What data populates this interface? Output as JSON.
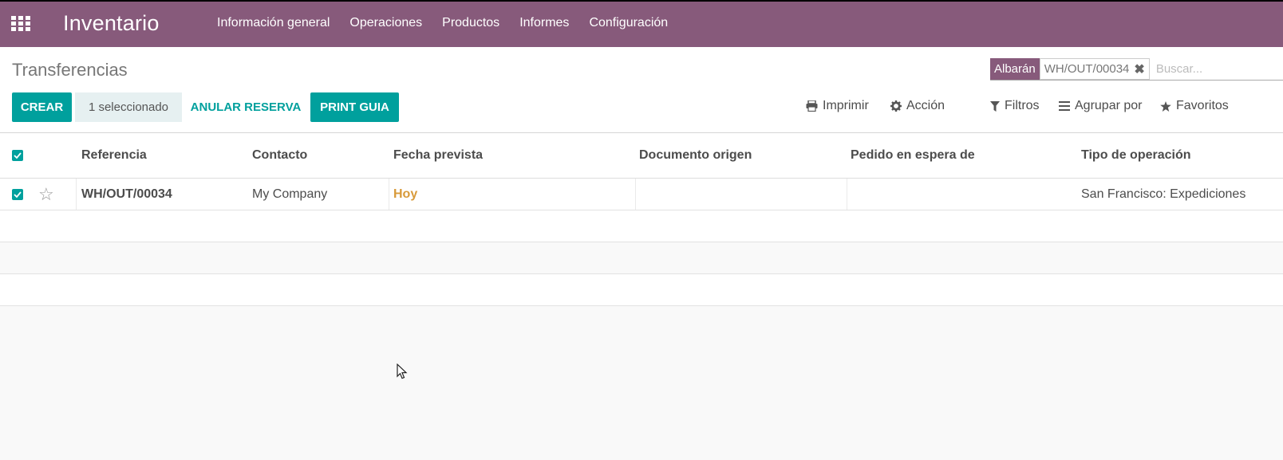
{
  "navbar": {
    "app_name": "Inventario",
    "menu": [
      "Información general",
      "Operaciones",
      "Productos",
      "Informes",
      "Configuración"
    ]
  },
  "control": {
    "breadcrumb": "Transferencias",
    "buttons": {
      "create": "CREAR",
      "selected": "1 seleccionado",
      "unreserve": "ANULAR RESERVA",
      "print_guia": "PRINT GUIA"
    },
    "search": {
      "facet_label": "Albarán",
      "facet_value": "WH/OUT/00034",
      "placeholder": "Buscar..."
    },
    "tools": {
      "print": "Imprimir",
      "action": "Acción",
      "filters": "Filtros",
      "group_by": "Agrupar por",
      "favorites": "Favoritos"
    }
  },
  "table": {
    "columns": [
      "Referencia",
      "Contacto",
      "Fecha prevista",
      "Documento origen",
      "Pedido en espera de",
      "Tipo de operación"
    ],
    "rows": [
      {
        "selected": true,
        "reference": "WH/OUT/00034",
        "contact": "My Company",
        "scheduled_date": "Hoy",
        "source_document": "",
        "backorder_of": "",
        "operation_type": "San Francisco: Expediciones"
      }
    ]
  },
  "colors": {
    "brand": "#875a7b",
    "accent": "#00a09d",
    "today": "#d89a3a"
  }
}
